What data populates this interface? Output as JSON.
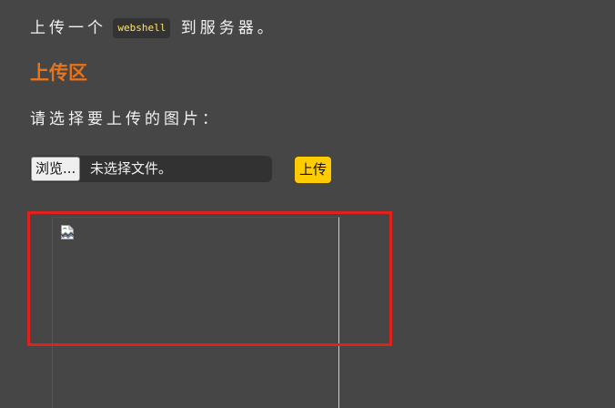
{
  "instruction": {
    "before": "上传一个",
    "code": "webshell",
    "after": "到服务器。"
  },
  "upload_section": {
    "title": "上传区",
    "prompt": "请选择要上传的图片：",
    "browse_label": "浏览...",
    "file_status": "未选择文件。",
    "upload_label": "上传"
  },
  "preview": {
    "icon": "broken-image-icon"
  },
  "colors": {
    "background": "#464646",
    "title": "#e8731a",
    "upload_button": "#ffcc00",
    "highlight": "#e0221d"
  }
}
